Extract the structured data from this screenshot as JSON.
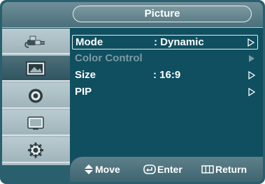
{
  "title": "Picture",
  "sidebar": {
    "items": [
      {
        "icon": "input-plug-icon",
        "selected": false
      },
      {
        "icon": "picture-icon",
        "selected": true
      },
      {
        "icon": "sound-icon",
        "selected": false
      },
      {
        "icon": "channel-icon",
        "selected": false
      },
      {
        "icon": "setup-gear-icon",
        "selected": false
      }
    ]
  },
  "menu": {
    "rows": [
      {
        "label": "Mode",
        "value": ": Dynamic",
        "state": "highlighted"
      },
      {
        "label": "Color Control",
        "value": "",
        "state": "disabled"
      },
      {
        "label": "Size",
        "value": ": 16:9",
        "state": "normal"
      },
      {
        "label": "PIP",
        "value": "",
        "state": "normal"
      }
    ]
  },
  "hints": {
    "move": "Move",
    "enter": "Enter",
    "return": "Return"
  },
  "colors": {
    "background": "#0f4f60",
    "sidebar": "#a9bdc3",
    "selected_tab": "#2f5561",
    "text": "#ffffff",
    "disabled_text": "#7f9aa2"
  }
}
